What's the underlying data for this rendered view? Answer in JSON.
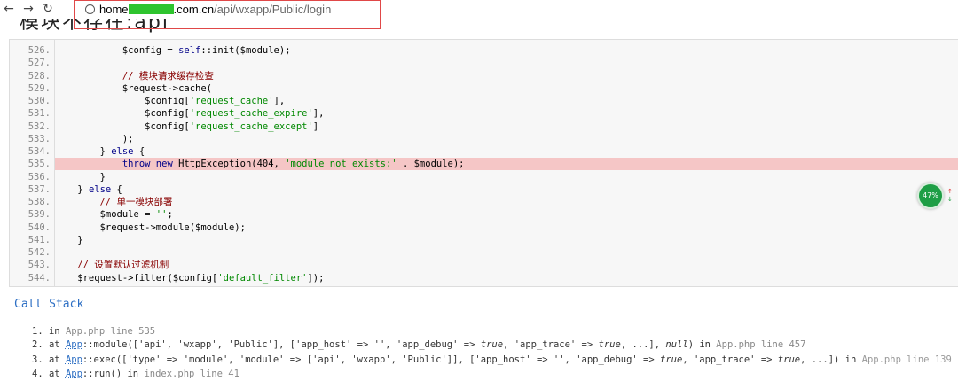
{
  "browser": {
    "back_icon": "←",
    "forward_icon": "→",
    "reload_icon": "↻",
    "info_icon": "i",
    "url_host_start": "home",
    "url_host_end": ".com.cn",
    "url_path": "/api/wxapp/Public/login",
    "url_mask_color": "#2ec42e"
  },
  "page": {
    "heading": "模块不存在:api"
  },
  "source_lines": [
    {
      "n": "526.",
      "c": "            $config = self::init($module);"
    },
    {
      "n": "527.",
      "c": ""
    },
    {
      "n": "528.",
      "c": "            // 模块请求缓存检查"
    },
    {
      "n": "529.",
      "c": "            $request->cache("
    },
    {
      "n": "530.",
      "c": "                $config['request_cache'],"
    },
    {
      "n": "531.",
      "c": "                $config['request_cache_expire'],"
    },
    {
      "n": "532.",
      "c": "                $config['request_cache_except']"
    },
    {
      "n": "533.",
      "c": "            );"
    },
    {
      "n": "534.",
      "c": "        } else {"
    },
    {
      "n": "535.",
      "c": "            throw new HttpException(404, 'module not exists:' . $module);"
    },
    {
      "n": "536.",
      "c": "        }"
    },
    {
      "n": "537.",
      "c": "    } else {"
    },
    {
      "n": "538.",
      "c": "        // 单一模块部署"
    },
    {
      "n": "539.",
      "c": "        $module = '';"
    },
    {
      "n": "540.",
      "c": "        $request->module($module);"
    },
    {
      "n": "541.",
      "c": "    }"
    },
    {
      "n": "542.",
      "c": ""
    },
    {
      "n": "543.",
      "c": "    // 设置默认过滤机制"
    },
    {
      "n": "544.",
      "c": "    $request->filter($config['default_filter']);"
    }
  ],
  "highlight_line": "535.",
  "call_stack": {
    "title": "Call Stack",
    "items": [
      [
        {
          "t": "1. in ",
          "k": ""
        },
        {
          "t": "App.php line 535",
          "k": "file"
        }
      ],
      [
        {
          "t": "2. at ",
          "k": ""
        },
        {
          "t": "App",
          "k": "cls"
        },
        {
          "t": "::module(['api', 'wxapp', 'Public'], ['app_host' => '', 'app_debug' => ",
          "k": ""
        },
        {
          "t": "true",
          "k": "kw"
        },
        {
          "t": ", 'app_trace' => ",
          "k": ""
        },
        {
          "t": "true",
          "k": "kw"
        },
        {
          "t": ", ...], ",
          "k": ""
        },
        {
          "t": "null",
          "k": "kw"
        },
        {
          "t": ") in ",
          "k": ""
        },
        {
          "t": "App.php line 457",
          "k": "file"
        }
      ],
      [
        {
          "t": "3. at ",
          "k": ""
        },
        {
          "t": "App",
          "k": "cls"
        },
        {
          "t": "::exec(['type' => 'module', 'module' => ['api', 'wxapp', 'Public']], ['app_host' => '', 'app_debug' => ",
          "k": ""
        },
        {
          "t": "true",
          "k": "kw"
        },
        {
          "t": ", 'app_trace' => ",
          "k": ""
        },
        {
          "t": "true",
          "k": "kw"
        },
        {
          "t": ", ...]) in ",
          "k": ""
        },
        {
          "t": "App.php line 139",
          "k": "dim"
        }
      ],
      [
        {
          "t": "4. at ",
          "k": ""
        },
        {
          "t": "App",
          "k": "cls"
        },
        {
          "t": "::run() in ",
          "k": ""
        },
        {
          "t": "index.php line 41",
          "k": "file"
        }
      ]
    ]
  },
  "widget": {
    "percent": "47%",
    "up_arrow": "↑",
    "down_arrow": "↓",
    "color": "#1e9e45"
  }
}
